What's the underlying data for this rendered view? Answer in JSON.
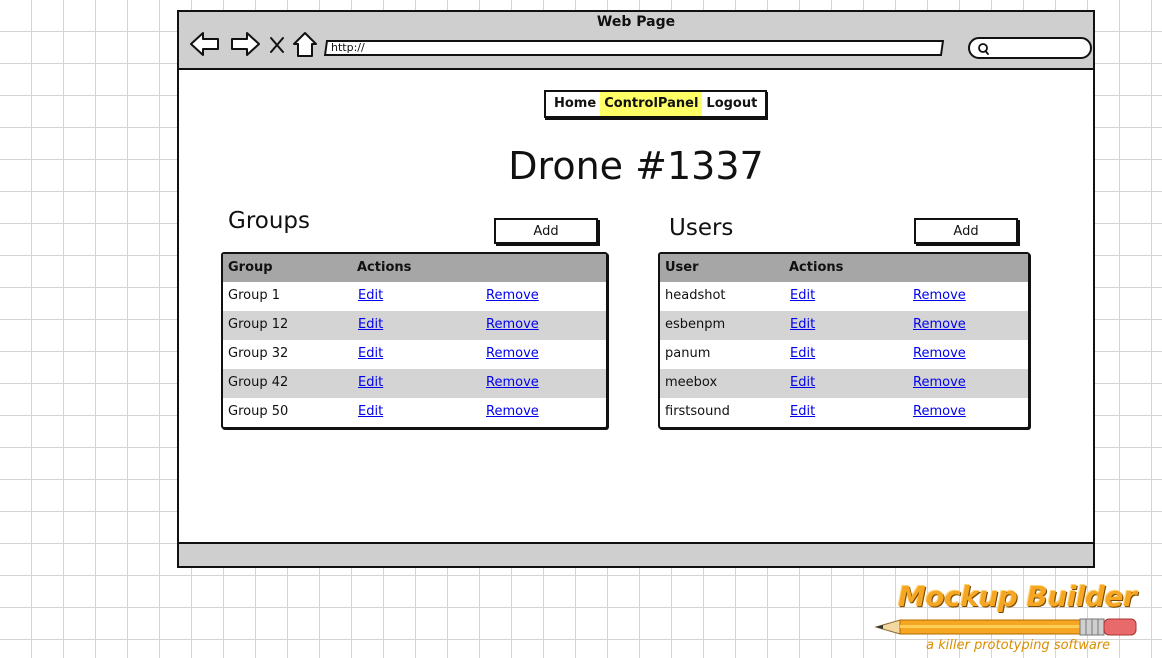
{
  "window": {
    "title": "Web Page",
    "url": "http://"
  },
  "nav": {
    "items": [
      {
        "label": "Home",
        "active": false
      },
      {
        "label": "ControlPanel",
        "active": true
      },
      {
        "label": "Logout",
        "active": false
      }
    ]
  },
  "page": {
    "title": "Drone #1337"
  },
  "groups": {
    "heading": "Groups",
    "add_label": "Add",
    "columns": [
      "Group",
      "Actions"
    ],
    "rows": [
      {
        "name": "Group 1",
        "edit": "Edit",
        "remove": "Remove"
      },
      {
        "name": "Group 12",
        "edit": "Edit",
        "remove": "Remove"
      },
      {
        "name": "Group 32",
        "edit": "Edit",
        "remove": "Remove"
      },
      {
        "name": "Group 42",
        "edit": "Edit",
        "remove": "Remove"
      },
      {
        "name": "Group 50",
        "edit": "Edit",
        "remove": "Remove"
      }
    ]
  },
  "users": {
    "heading": "Users",
    "add_label": "Add",
    "columns": [
      "User",
      "Actions"
    ],
    "rows": [
      {
        "name": "headshot",
        "edit": "Edit",
        "remove": "Remove"
      },
      {
        "name": "esbenpm",
        "edit": "Edit",
        "remove": "Remove"
      },
      {
        "name": "panum",
        "edit": "Edit",
        "remove": "Remove"
      },
      {
        "name": "meebox",
        "edit": "Edit",
        "remove": "Remove"
      },
      {
        "name": "firstsound",
        "edit": "Edit",
        "remove": "Remove"
      }
    ]
  },
  "branding": {
    "name": "Mockup Builder",
    "tagline": "a killer prototyping software"
  },
  "colors": {
    "nav_active": "#ffff66",
    "table_header": "#a6a6a6",
    "row_alt": "#d4d4d4",
    "link": "#0000ee",
    "chrome": "#cfcfcf",
    "logo": "#f5a623"
  },
  "icons": [
    "back-arrow-icon",
    "forward-arrow-icon",
    "close-icon",
    "home-icon",
    "search-icon",
    "pencil-icon"
  ]
}
